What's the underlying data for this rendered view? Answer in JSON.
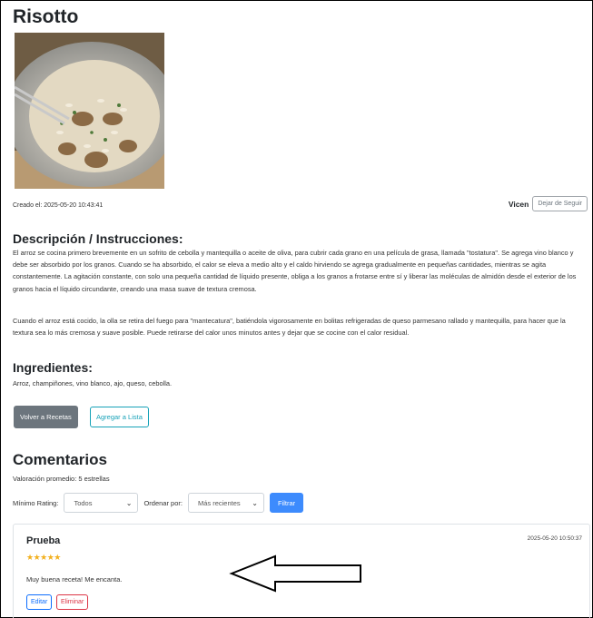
{
  "recipe": {
    "title": "Risotto",
    "image_alt": "Plato de risotto con champiñones",
    "created_label": "Creado el: 2025-05-20 10:43:41",
    "author": "Vicen",
    "unfollow_button": "Dejar de Seguir"
  },
  "description": {
    "heading": "Descripción / Instrucciones:",
    "paragraph1": "El arroz se cocina primero brevemente en un sofrito de cebolla y mantequilla o aceite de oliva, para cubrir cada grano en una película de grasa, llamada \"tostatura\". Se agrega vino blanco y debe ser absorbido por los granos. Cuando se ha absorbido, el calor se eleva a medio alto y el caldo hirviendo se agrega gradualmente en pequeñas cantidades, mientras se agita constantemente. La agitación constante, con solo una pequeña cantidad de líquido presente, obliga a los granos a frotarse entre sí y liberar las moléculas de almidón desde el exterior de los granos hacia el líquido circundante, creando una masa suave de textura cremosa.",
    "paragraph2": "Cuando el arroz está cocido, la olla se retira del fuego para \"mantecatura\", batiéndola vigorosamente en bolitas refrigeradas de queso parmesano rallado y mantequilla, para hacer que la textura sea lo más cremosa y suave posible. Puede retirarse del calor unos minutos antes y dejar que se cocine con el calor residual."
  },
  "ingredients": {
    "heading": "Ingredientes:",
    "text": "Arroz, champiñones, vino blanco, ajo, queso, cebolla."
  },
  "actions": {
    "back_button": "Volver a Recetas",
    "add_list_button": "Agregar a Lista"
  },
  "comments": {
    "heading": "Comentarios",
    "average_rating": "Valoración promedio: 5 estrellas",
    "filter": {
      "min_rating_label": "Mínimo Rating:",
      "min_rating_value": "Todos",
      "order_label": "Ordenar por:",
      "order_value": "Más recientes",
      "filter_button": "Filtrar"
    },
    "items": [
      {
        "author": "Prueba",
        "date": "2025-05-20 10:50:37",
        "stars": "★★★★★",
        "rating": 5,
        "text": "Muy buena receta! Me encanta.",
        "edit_button": "Editar",
        "delete_button": "Eliminar"
      }
    ]
  },
  "colors": {
    "primary": "#3d8bfd",
    "secondary": "#6c757d",
    "info": "#17a2b8",
    "danger": "#dc3545",
    "star": "#f2b01e"
  }
}
